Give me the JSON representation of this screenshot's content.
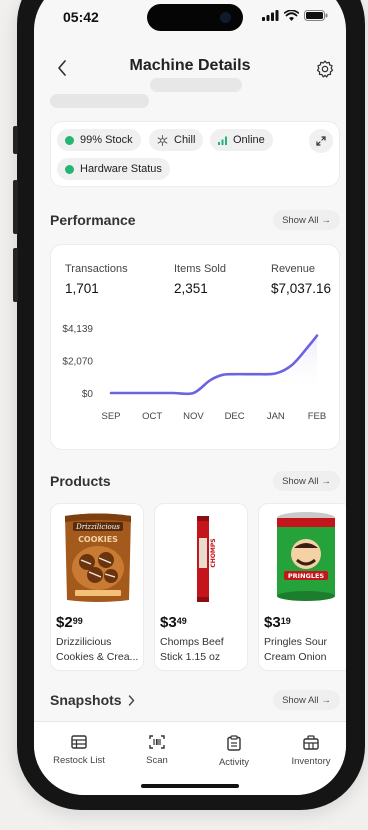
{
  "status_bar": {
    "time": "05:42"
  },
  "header": {
    "title": "Machine Details"
  },
  "status_chips": [
    {
      "label": "99% Stock",
      "status_color": "#22b573"
    },
    {
      "label": "Chill",
      "icon": "snowflake-icon"
    },
    {
      "label": "Online",
      "icon": "signal-icon",
      "status_color": "#22b573"
    },
    {
      "label": "Hardware Status",
      "status_color": "#22b573"
    }
  ],
  "performance": {
    "title": "Performance",
    "show_all": "Show All",
    "metrics": [
      {
        "label": "Transactions",
        "value": "1,701"
      },
      {
        "label": "Items Sold",
        "value": "2,351"
      },
      {
        "label": "Revenue",
        "value": "$7,037.16"
      }
    ]
  },
  "chart_data": {
    "type": "line",
    "title": "",
    "xlabel": "",
    "ylabel": "",
    "categories": [
      "SEP",
      "OCT",
      "NOV",
      "DEC",
      "JAN",
      "FEB"
    ],
    "y_ticks": [
      "$4,139",
      "$2,070",
      "$0"
    ],
    "ylim": [
      0,
      4139
    ],
    "grid": false,
    "line_color": "#6c63e0",
    "series": [
      {
        "x": [
          0,
          0.5,
          1,
          1.5,
          2,
          2.4,
          2.7,
          3,
          3.5,
          4,
          4.4,
          4.8,
          5
        ],
        "values": [
          0,
          0,
          0,
          0,
          0,
          800,
          1150,
          1200,
          1200,
          1250,
          1800,
          3000,
          3650
        ]
      }
    ]
  },
  "products": {
    "title": "Products",
    "show_all": "Show All",
    "items": [
      {
        "price_dollars": "$2",
        "price_cents": "99",
        "name_line1": "Drizzilicious",
        "name_line2": "Cookies & Crea..."
      },
      {
        "price_dollars": "$3",
        "price_cents": "49",
        "name_line1": "Chomps Beef",
        "name_line2": "Stick 1.15 oz"
      },
      {
        "price_dollars": "$3",
        "price_cents": "19",
        "name_line1": "Pringles Sour",
        "name_line2": "Cream Onion"
      }
    ]
  },
  "snapshots": {
    "title": "Snapshots",
    "show_all": "Show All"
  },
  "tabbar": [
    {
      "label": "Restock List",
      "icon": "restock-list-icon"
    },
    {
      "label": "Scan",
      "icon": "scan-icon"
    },
    {
      "label": "Activity",
      "icon": "clipboard-icon"
    },
    {
      "label": "Inventory",
      "icon": "inventory-icon"
    }
  ]
}
